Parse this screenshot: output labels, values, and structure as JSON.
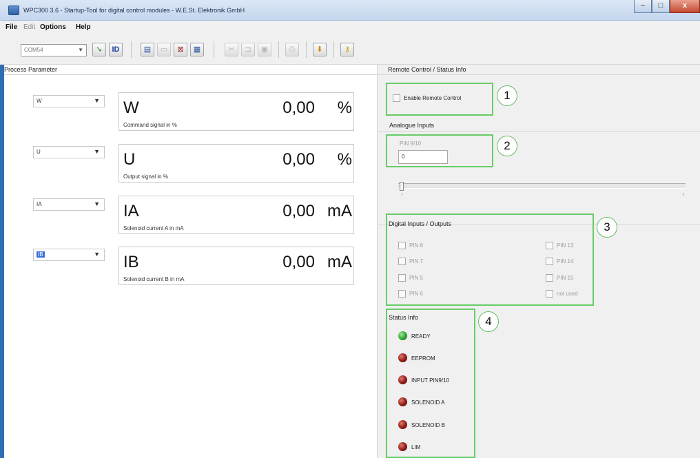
{
  "window": {
    "title": "WPC300 3.6 - Startup-Tool for digital control modules  -  W.E.St. Elektronik GmbH",
    "controls": {
      "minimize": "–",
      "maximize": "□",
      "close": "x"
    }
  },
  "menu": {
    "file": "File",
    "edit": "Edit",
    "options": "Options",
    "help": "Help"
  },
  "toolbar": {
    "com_port": "COM54"
  },
  "process_parameter": {
    "heading": "Process Parameter",
    "rows": [
      {
        "select": "W",
        "label": "W",
        "value": "0,00",
        "unit": "%",
        "desc": "Command signal in %"
      },
      {
        "select": "U",
        "label": "U",
        "value": "0,00",
        "unit": "%",
        "desc": "Output signal in %"
      },
      {
        "select": "IA",
        "label": "IA",
        "value": "0,00",
        "unit": "mA",
        "desc": "Solenoid current A in mA"
      },
      {
        "select": "IB",
        "label": "IB",
        "value": "0,00",
        "unit": "mA",
        "desc": "Solenoid current B in mA"
      }
    ]
  },
  "remote": {
    "heading": "Remote Control / Status Info",
    "enable_label": "Enable Remote Control"
  },
  "analogue": {
    "heading": "Analogue Inputs",
    "pin_label": "PIN 9/10",
    "value": "0"
  },
  "digital": {
    "heading": "Digital Inputs / Outputs",
    "left": [
      "PIN 8",
      "PIN 7",
      "PIN 5",
      "PIN 6"
    ],
    "right": [
      "PIN 13",
      "PIN 14",
      "PIN 15",
      "not used"
    ]
  },
  "status": {
    "heading": "Status Info",
    "items": [
      {
        "label": "READY",
        "color": "#2fa62f"
      },
      {
        "label": "EEPROM",
        "color": "#8e1a14"
      },
      {
        "label": "INPUT PIN9/10",
        "color": "#8e1a14"
      },
      {
        "label": "SOLENOID A",
        "color": "#8e1a14"
      },
      {
        "label": "SOLENOID B",
        "color": "#8e1a14"
      },
      {
        "label": "LIM",
        "color": "#8e1a14"
      }
    ]
  },
  "annotations": [
    "1",
    "2",
    "3",
    "4"
  ]
}
